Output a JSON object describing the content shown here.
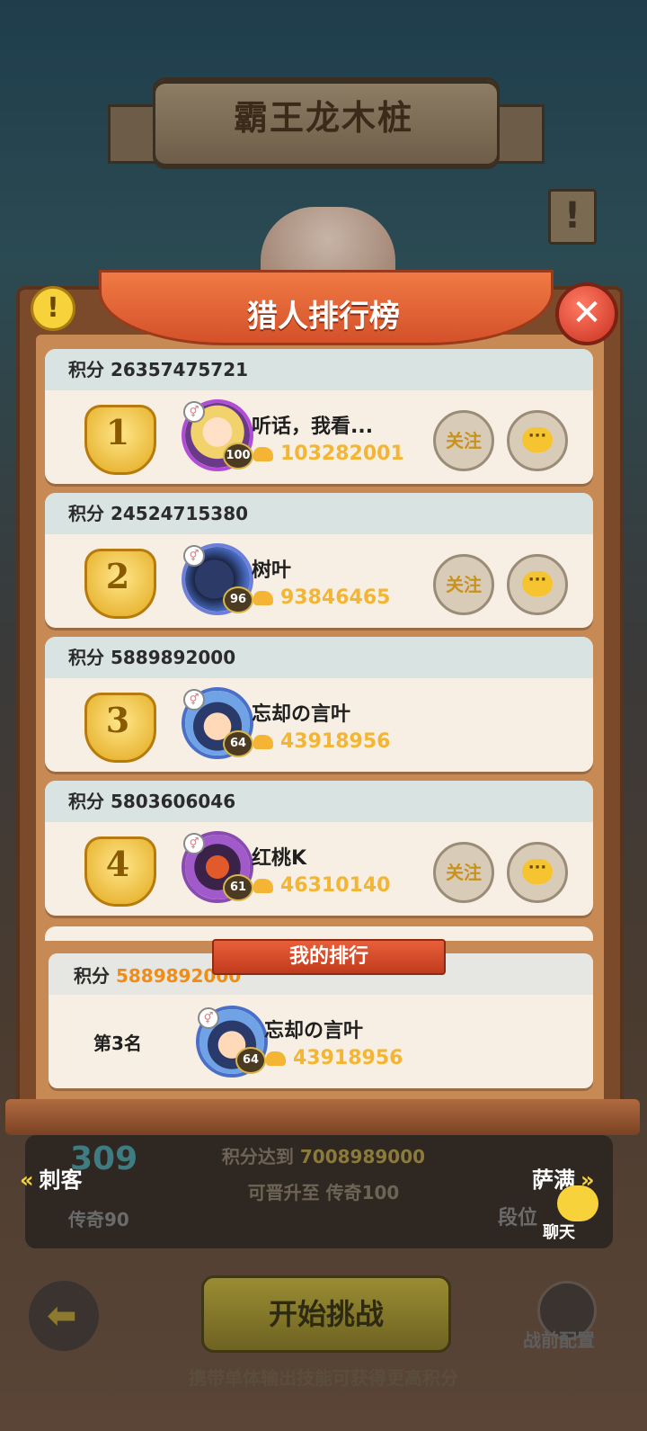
{
  "header": {
    "title": "霸王龙木桩"
  },
  "leaderboard": {
    "title": "猎人排行榜",
    "score_label": "积分",
    "follow_label": "关注",
    "entries": [
      {
        "rank": "1",
        "score": "26357475721",
        "name": "听话，我看...",
        "level": "100",
        "power": "103282001",
        "has_actions": true
      },
      {
        "rank": "2",
        "score": "24524715380",
        "name": "树叶",
        "level": "96",
        "power": "93846465",
        "has_actions": true
      },
      {
        "rank": "3",
        "score": "5889892000",
        "name": "忘却の言叶",
        "level": "64",
        "power": "43918956",
        "has_actions": false
      },
      {
        "rank": "4",
        "score": "5803606046",
        "name": "红桃K",
        "level": "61",
        "power": "46310140",
        "has_actions": true
      }
    ]
  },
  "my_rank": {
    "title": "我的排行",
    "score_label": "积分",
    "score": "5889892000",
    "place": "第3名",
    "name": "忘却の言叶",
    "level": "64",
    "power": "43918956"
  },
  "progress": {
    "line1_prefix": "积分达到",
    "line1_value": "7008989000",
    "line2": "可晋升至 传奇100",
    "rank_number": "309",
    "rank_name": "传奇90"
  },
  "nav": {
    "prev": "刺客",
    "next": "萨满",
    "segment_prefix": "段位"
  },
  "chat_label": "聊天",
  "start_button": "开始挑战",
  "pre_config": "战前配置",
  "tip": "携带单体输出技能可获得更高积分",
  "colors": {
    "accent": "#f3b533",
    "ribbon": "#e06438",
    "score_highlight": "#f08c18"
  }
}
